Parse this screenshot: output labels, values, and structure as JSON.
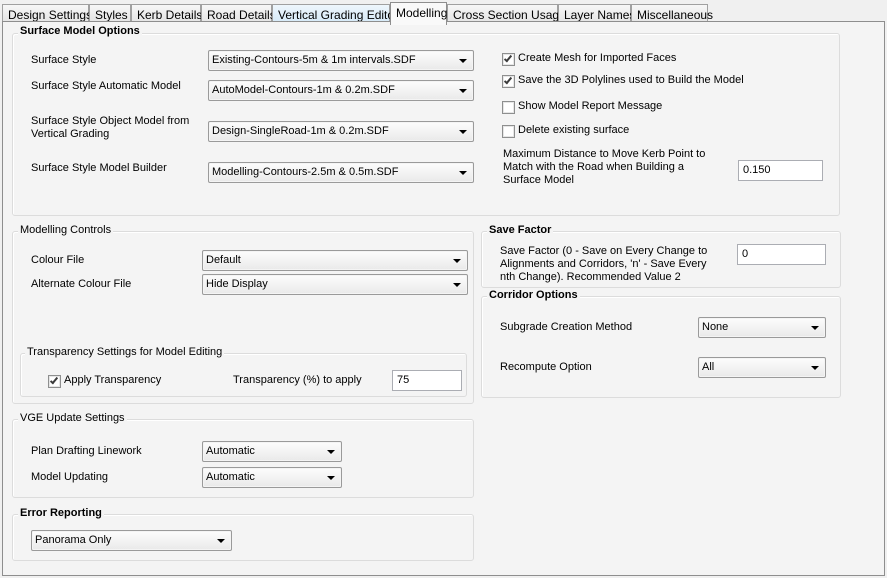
{
  "tabs": [
    {
      "label": "Design Settings"
    },
    {
      "label": "Styles"
    },
    {
      "label": "Kerb Details"
    },
    {
      "label": "Road Details"
    },
    {
      "label": "Vertical Grading Editor"
    },
    {
      "label": "Modelling"
    },
    {
      "label": "Cross Section Usage"
    },
    {
      "label": "Layer Names"
    },
    {
      "label": "Miscellaneous"
    }
  ],
  "active_tab": "Modelling",
  "surface_model": {
    "title": "Surface Model Options",
    "surface_style_label": "Surface Style",
    "surface_style_value": "Existing-Contours-5m & 1m intervals.SDF",
    "auto_model_label": "Surface Style Automatic Model",
    "auto_model_value": "AutoModel-Contours-1m & 0.2m.SDF",
    "object_model_label": "Surface Style Object Model from Vertical Grading",
    "object_model_value": "Design-SingleRoad-1m & 0.2m.SDF",
    "model_builder_label": "Surface Style Model Builder",
    "model_builder_value": "Modelling-Contours-2.5m & 0.5m.SDF",
    "create_mesh_label": "Create Mesh for Imported Faces",
    "create_mesh_checked": true,
    "save_polylines_label": "Save the 3D Polylines used to Build the Model",
    "save_polylines_checked": true,
    "show_report_label": "Show Model Report Message",
    "show_report_checked": false,
    "delete_surface_label": "Delete existing surface",
    "delete_surface_checked": false,
    "max_distance_label": "Maximum Distance to Move Kerb Point to Match with the Road when Building a Surface Model",
    "max_distance_value": "0.150"
  },
  "modelling_controls": {
    "title": "Modelling Controls",
    "colour_file_label": "Colour File",
    "colour_file_value": "Default",
    "alt_colour_file_label": "Alternate Colour File",
    "alt_colour_file_value": "Hide Display",
    "transparency_group_title": "Transparency Settings for Model Editing",
    "apply_transparency_label": "Apply Transparency",
    "apply_transparency_checked": true,
    "transparency_pct_label": "Transparency (%) to apply",
    "transparency_pct_value": "75"
  },
  "vge_update": {
    "title": "VGE Update Settings",
    "plan_drafting_label": "Plan Drafting Linework",
    "plan_drafting_value": "Automatic",
    "model_updating_label": "Model Updating",
    "model_updating_value": "Automatic"
  },
  "error_reporting": {
    "title": "Error Reporting",
    "value": "Panorama Only"
  },
  "save_factor": {
    "title": "Save Factor",
    "label": "Save Factor (0 - Save on Every Change to Alignments and Corridors, 'n' - Save Every nth Change). Recommended Value 2",
    "value": "0"
  },
  "corridor_options": {
    "title": "Corridor Options",
    "subgrade_label": "Subgrade Creation Method",
    "subgrade_value": "None",
    "recompute_label": "Recompute Option",
    "recompute_value": "All"
  },
  "colors": {
    "tab_highlight": "#d5e9f7",
    "panel_bg": "#f4f4f4",
    "window_bg": "#f0f0f0"
  }
}
